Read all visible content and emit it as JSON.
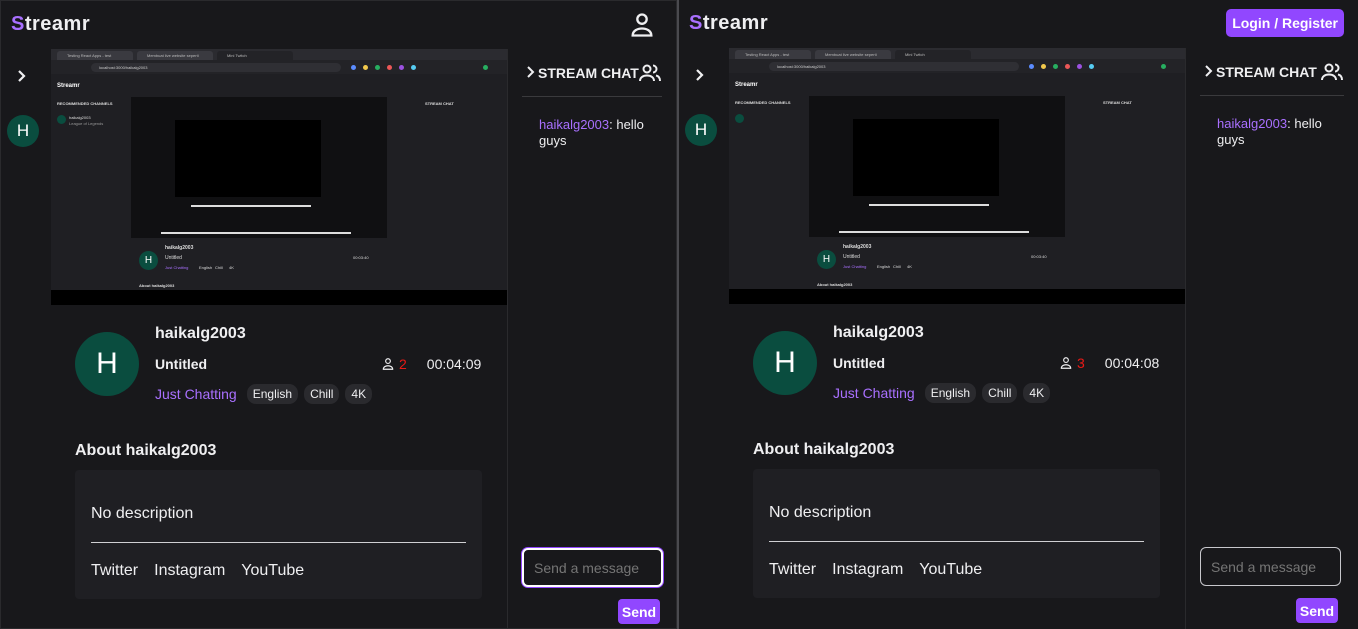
{
  "app": {
    "logo_first": "S",
    "logo_rest": "treamr"
  },
  "colors": {
    "accent": "#9147ff",
    "accent_text": "#a970ff",
    "live_red": "#e91916",
    "bg": "#0e0e10",
    "panel": "#18181b",
    "avatar": "#0a4d3f"
  },
  "panes": [
    {
      "header": {
        "right_control": "user-icon"
      },
      "sidebar": {
        "avatar_letter": "H"
      },
      "stream": {
        "avatar_letter": "H",
        "streamer": "haikalg2003",
        "title": "Untitled",
        "viewers": "2",
        "uptime": "00:04:09",
        "category": "Just Chatting",
        "tags": [
          "English",
          "Chill",
          "4K"
        ]
      },
      "about": {
        "heading": "About haikalg2003",
        "description": "No description",
        "links": [
          "Twitter",
          "Instagram",
          "YouTube"
        ]
      },
      "chat": {
        "title": "STREAM CHAT",
        "messages": [
          {
            "user": "haikalg2003",
            "text": ": hello guys"
          }
        ],
        "input_placeholder": "Send a message",
        "send_label": "Send"
      },
      "preview": {
        "tabs": [
          "Testing React Apps - test",
          "Membuat live website seperti",
          "Mini Twitch"
        ],
        "url": "localhost:3000/haikalg2003",
        "logo": "Streamr",
        "section": "RECOMMENDED CHANNELS",
        "chat_title": "STREAM CHAT",
        "channel_name": "haikalg2003",
        "channel_game": "League of Legends",
        "streamer": "haikalg2003",
        "title": "Untitled",
        "category": "Just Chatting",
        "tags": [
          "English",
          "Chill",
          "4K"
        ],
        "uptime": "00:03:40",
        "about": "About haikalg2003"
      }
    },
    {
      "header": {
        "login_label": "Login / Register"
      },
      "sidebar": {
        "avatar_letter": "H"
      },
      "stream": {
        "avatar_letter": "H",
        "streamer": "haikalg2003",
        "title": "Untitled",
        "viewers": "3",
        "uptime": "00:04:08",
        "category": "Just Chatting",
        "tags": [
          "English",
          "Chill",
          "4K"
        ]
      },
      "about": {
        "heading": "About haikalg2003",
        "description": "No description",
        "links": [
          "Twitter",
          "Instagram",
          "YouTube"
        ]
      },
      "chat": {
        "title": "STREAM CHAT",
        "messages": [
          {
            "user": "haikalg2003",
            "text": ": hello guys"
          }
        ],
        "input_placeholder": "Send a message",
        "send_label": "Send"
      },
      "preview": {
        "tabs": [
          "Testing React Apps - test",
          "Membuat live website seperti",
          "Mini Twitch"
        ],
        "url": "localhost:3000/haikalg2003",
        "logo": "Streamr",
        "section": "RECOMMENDED CHANNELS",
        "chat_title": "STREAM CHAT",
        "streamer": "haikalg2003",
        "title": "Untitled",
        "category": "Just Chatting",
        "tags": [
          "English",
          "Chill",
          "4K"
        ],
        "uptime": "00:03:40",
        "about": "About haikalg2003"
      }
    }
  ]
}
